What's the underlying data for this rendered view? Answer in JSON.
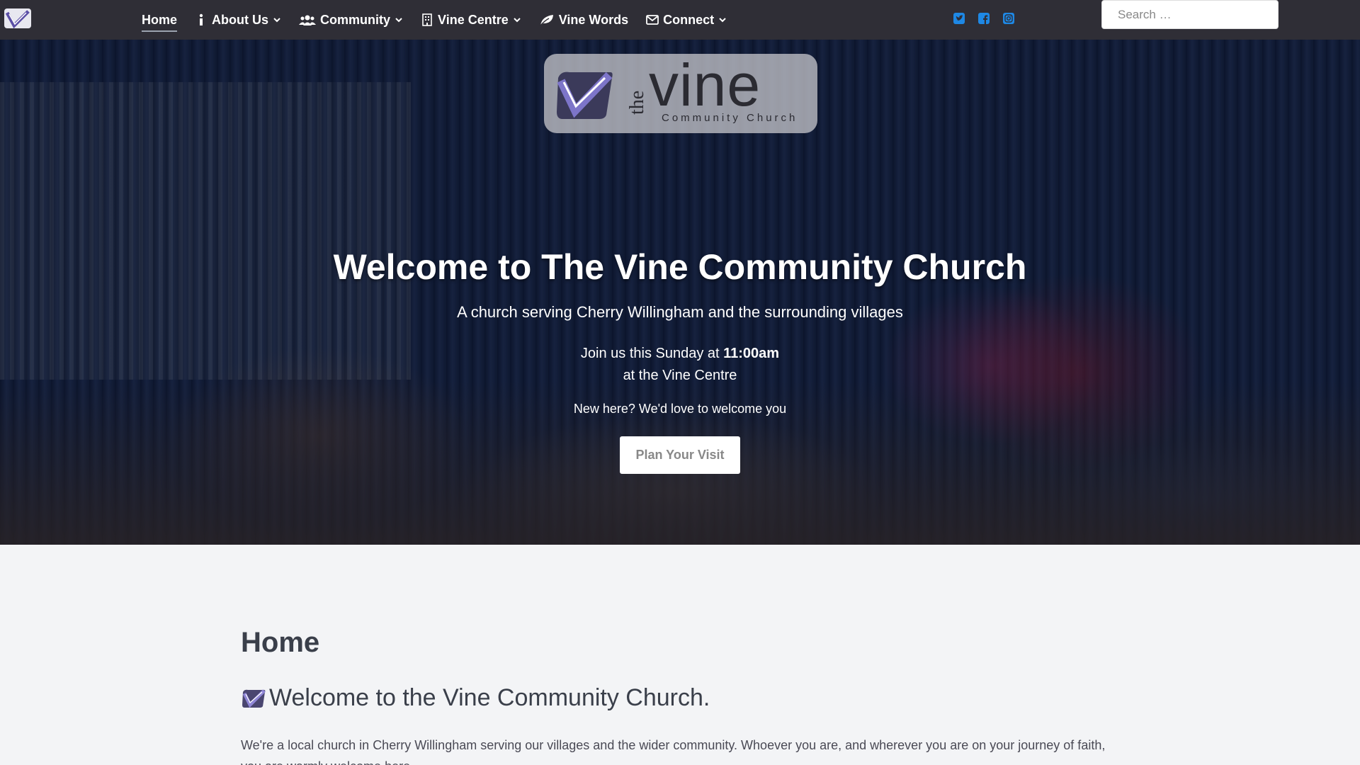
{
  "nav": {
    "items": [
      {
        "label": "Home",
        "icon": "none",
        "active": true
      },
      {
        "label": "About Us",
        "icon": "info-icon"
      },
      {
        "label": "Community",
        "icon": "users-icon"
      },
      {
        "label": "Vine Centre",
        "icon": "building-icon"
      },
      {
        "label": "Vine Words",
        "icon": "leaf-icon"
      },
      {
        "label": "Connect",
        "icon": "envelope-icon"
      }
    ],
    "socials": [
      "twitter-icon",
      "facebook-icon",
      "instagram-icon"
    ],
    "social_color": "#1e88e5",
    "search_placeholder": "Search …"
  },
  "hero": {
    "logo_the": "the",
    "logo_vine": "vine",
    "logo_sub": "Community Church",
    "title": "Welcome to The Vine Community Church",
    "tagline": "A church serving Cherry Willingham and the surrounding villages",
    "join_prefix": "Join us this Sunday at ",
    "join_time": "11:00am",
    "join_place": "at the Vine Centre",
    "new_here": "New here? We'd love to welcome you",
    "cta": "Plan Your Visit"
  },
  "content": {
    "page_title": "Home",
    "welcome_heading": "Welcome to the Vine Community Church.",
    "intro": "We're a local church in Cherry Willingham serving our villages and the wider community. Whoever you are, and wherever you are on your journey of faith, you are warmly welcome here."
  },
  "colors": {
    "nav_bg": "#2f2e36",
    "page_bg": "#f3f4f6",
    "brand_purple": "#6b5fb5"
  }
}
